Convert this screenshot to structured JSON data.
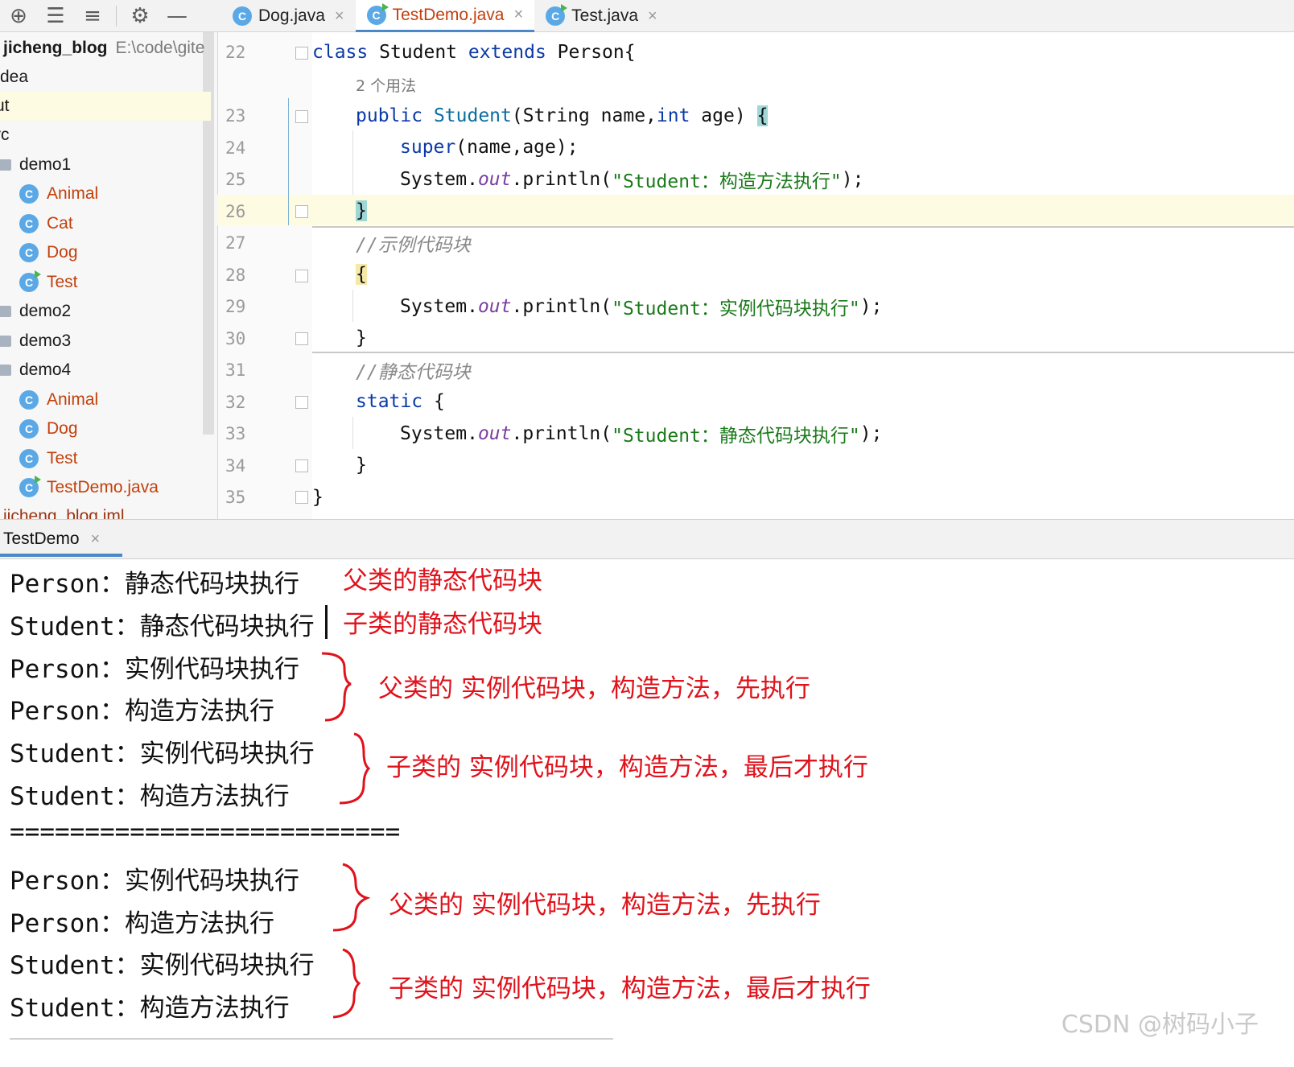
{
  "toolbar": {
    "icons": [
      "crosshair-icon",
      "expand-all-icon",
      "collapse-all-icon",
      "gear-icon",
      "minimize-icon"
    ],
    "glyphs": [
      "⊕",
      "☰",
      "≡",
      "⚙",
      "—"
    ]
  },
  "tabs": [
    {
      "label": "Dog.java",
      "icon": "C",
      "close": "×"
    },
    {
      "label": "TestDemo.java",
      "icon": "C",
      "close": "×"
    },
    {
      "label": "Test.java",
      "icon": "C",
      "close": "×"
    }
  ],
  "tree": {
    "project_name": "jicheng_blog",
    "project_path": "E:\\code\\gite",
    "items": [
      {
        "label": "dea"
      },
      {
        "label": "ut"
      },
      {
        "label": "rc"
      },
      {
        "label": "demo1"
      },
      {
        "label": "Animal"
      },
      {
        "label": "Cat"
      },
      {
        "label": "Dog"
      },
      {
        "label": "Test"
      },
      {
        "label": "demo2"
      },
      {
        "label": "demo3"
      },
      {
        "label": "demo4"
      },
      {
        "label": "Animal"
      },
      {
        "label": "Dog"
      },
      {
        "label": "Test"
      },
      {
        "label": "TestDemo.java"
      },
      {
        "label": "jicheng_blog.iml"
      }
    ],
    "class_icon": "C"
  },
  "editor": {
    "line_numbers": [
      "22",
      "23",
      "24",
      "25",
      "26",
      "27",
      "28",
      "29",
      "30",
      "31",
      "32",
      "33",
      "34",
      "35"
    ],
    "usage_hint": "2 个用法",
    "code": {
      "l22_kw1": "class",
      "l22_txt": " Student ",
      "l22_kw2": "extends",
      "l22_txt2": " Person{",
      "l23_kw": "public",
      "l23_ctor": " Student",
      "l23_txt": "(String name,",
      "l23_kw2": "int",
      "l23_txt2": " age) ",
      "l23_brace": "{",
      "l24_kw": "super",
      "l24_txt": "(name,age);",
      "l25_a": "System.",
      "l25_b": "out",
      "l25_c": ".println(",
      "l25_str": "\"Student：构造方法执行\"",
      "l25_d": ");",
      "l26_brace": "}",
      "l27_cmt": "//示例代码块",
      "l28_brace": "{",
      "l29_a": "System.",
      "l29_b": "out",
      "l29_c": ".println(",
      "l29_str": "\"Student：实例代码块执行\"",
      "l29_d": ");",
      "l30_brace": "}",
      "l31_cmt": "//静态代码块",
      "l32_kw": "static",
      "l32_txt": " {",
      "l33_a": "System.",
      "l33_b": "out",
      "l33_c": ".println(",
      "l33_str": "\"Student：静态代码块执行\"",
      "l33_d": ");",
      "l34_brace": "}",
      "l35_brace": "}"
    }
  },
  "run": {
    "tab_label": "TestDemo",
    "tab_close": "×",
    "output": [
      "Person：静态代码块执行",
      "Student：静态代码块执行",
      "Person：实例代码块执行",
      "Person：构造方法执行",
      "Student：实例代码块执行",
      "Student：构造方法执行",
      "==========================",
      "Person：实例代码块执行",
      "Person：构造方法执行",
      "Student：实例代码块执行",
      "Student：构造方法执行"
    ],
    "annotations": [
      "父类的静态代码块",
      "子类的静态代码块",
      "父类的 实例代码块，构造方法，先执行",
      "子类的 实例代码块，构造方法，最后才执行",
      "父类的 实例代码块，构造方法，先执行",
      "子类的 实例代码块，构造方法，最后才执行"
    ],
    "annotation_color": "#e0121b"
  },
  "watermark": "CSDN @树码小子"
}
